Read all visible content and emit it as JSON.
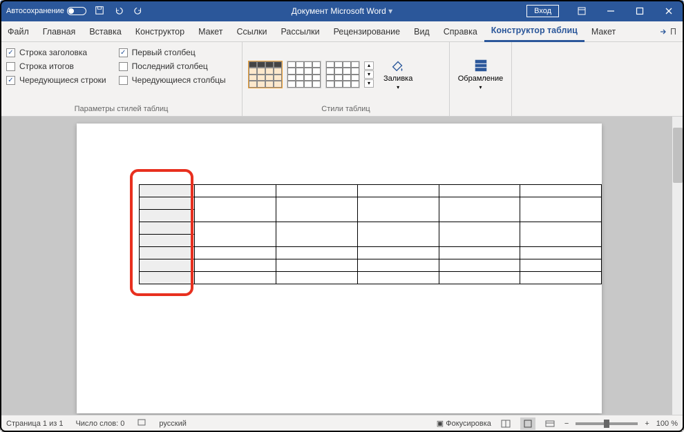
{
  "titlebar": {
    "autosave": "Автосохранение",
    "title": "Документ Microsoft Word",
    "login": "Вход"
  },
  "menu": {
    "tabs": [
      "Файл",
      "Главная",
      "Вставка",
      "Конструктор",
      "Макет",
      "Ссылки",
      "Рассылки",
      "Рецензирование",
      "Вид",
      "Справка"
    ],
    "active_tab": "Конструктор таблиц",
    "extra_tab": "Макет"
  },
  "ribbon": {
    "checks_left": [
      {
        "label": "Строка заголовка",
        "checked": true
      },
      {
        "label": "Строка итогов",
        "checked": false
      },
      {
        "label": "Чередующиеся строки",
        "checked": true
      }
    ],
    "checks_right": [
      {
        "label": "Первый столбец",
        "checked": true
      },
      {
        "label": "Последний столбец",
        "checked": false
      },
      {
        "label": "Чередующиеся столбцы",
        "checked": false
      }
    ],
    "group1_label": "Параметры стилей таблиц",
    "group2_label": "Стили таблиц",
    "fill_label": "Заливка",
    "border_label": "Обрамление"
  },
  "status": {
    "page": "Страница 1 из 1",
    "words": "Число слов: 0",
    "lang": "русский",
    "focus": "Фокусировка",
    "zoom": "100 %"
  }
}
